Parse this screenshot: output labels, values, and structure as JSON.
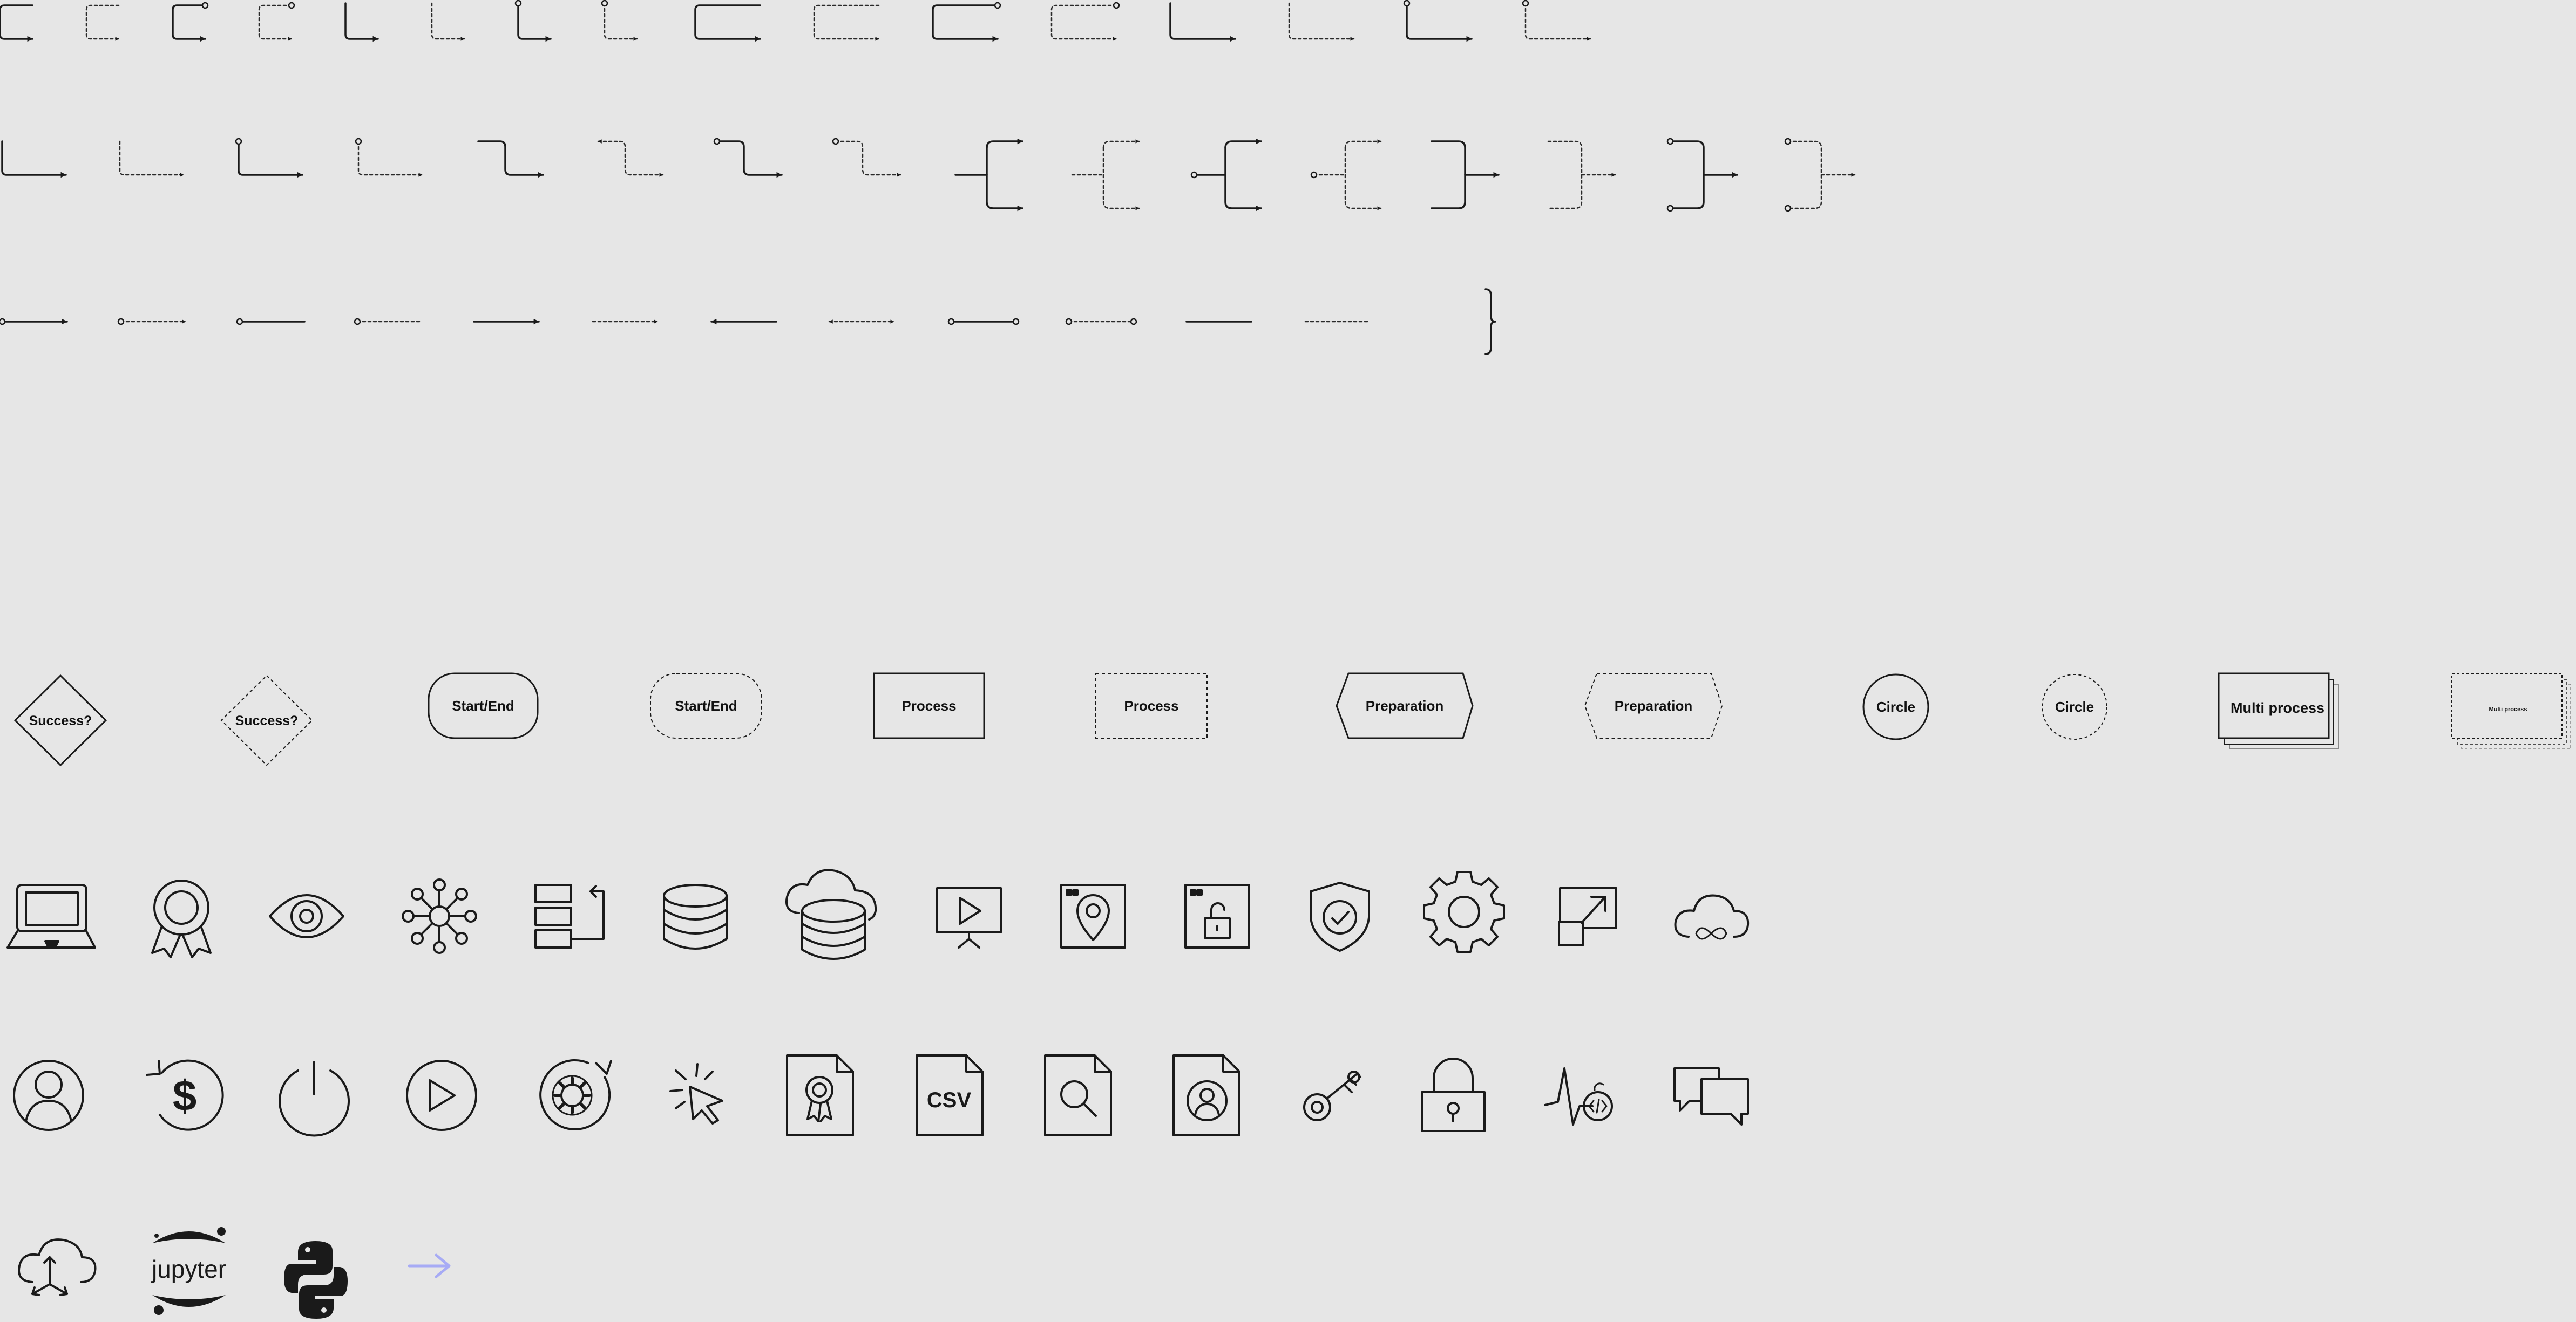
{
  "palette": {
    "background": "#e6e6e6",
    "stroke": "#1a1a1a",
    "dashed_stroke": "#2a2a2a",
    "arrow_accent": "#a7abf5"
  },
  "connectors": {
    "row1": [
      "elbow-bracket-arrow",
      "elbow-bracket-arrow-dashed",
      "elbow-bracket-dot-arrow",
      "elbow-bracket-dot-arrow-dashed",
      "elbow-down-right-arrow",
      "elbow-down-right-arrow-dashed",
      "elbow-down-right-dot-arrow",
      "elbow-down-right-dot-arrow-dashed",
      "wide-bracket-arrow",
      "wide-bracket-arrow-dashed",
      "wide-bracket-dot-arrow",
      "wide-bracket-dot-arrow-dashed",
      "wide-down-right-arrow",
      "wide-down-right-arrow-dashed",
      "wide-down-right-dot-arrow",
      "wide-down-right-dot-arrow-dashed"
    ],
    "row2": [
      "elbow-long-arrow",
      "elbow-long-arrow-dashed",
      "elbow-long-dot-arrow",
      "elbow-long-dot-arrow-dashed",
      "step-right-arrow",
      "step-right-back-arrow",
      "step-right-dot-arrow",
      "step-right-dot-arrow-dashed",
      "fork-left-arrow",
      "fork-left-arrow-dashed",
      "fork-left-dot-arrow",
      "fork-left-dot-arrow-dashed",
      "fork-right-arrow",
      "fork-right-arrow-dashed",
      "fork-right-dot-arrow",
      "fork-right-dot-arrow-dashed"
    ],
    "row3": [
      "straight-dot-arrow",
      "straight-dot-arrow-dashed",
      "straight-dot-line",
      "straight-dot-line-dashed",
      "straight-arrow",
      "straight-arrow-dashed",
      "straight-back-arrow",
      "straight-double-arrow-dashed",
      "straight-dot-dot-line",
      "straight-dot-dot-line-dashed",
      "straight-line",
      "straight-line-dashed",
      "curly-brace"
    ]
  },
  "flowchart_shapes": {
    "decision_label": "Success?",
    "decision_dashed_label": "Success?",
    "terminal_label": "Start/End",
    "terminal_dashed_label": "Start/End",
    "process_label": "Process",
    "process_dashed_label": "Process",
    "preparation_label": "Preparation",
    "preparation_dashed_label": "Preparation",
    "circle_label": "Circle",
    "circle_dashed_label": "Circle",
    "multi_process_label": "Multi process",
    "multi_process_dashed_label": "Multi process"
  },
  "icons": {
    "row1": [
      "laptop-icon",
      "award-ribbon-icon",
      "eye-icon",
      "network-hub-icon",
      "list-flow-icon",
      "database-icon",
      "cloud-database-icon",
      "presentation-play-icon",
      "window-location-icon",
      "window-unlock-icon",
      "shield-check-icon",
      "gear-icon",
      "resize-expand-icon",
      "cloud-infinity-icon"
    ],
    "row2": [
      "user-circle-icon",
      "dollar-refresh-icon",
      "power-icon",
      "play-circle-icon",
      "gear-refresh-icon",
      "cursor-click-icon",
      "document-award-icon",
      "document-csv-icon",
      "document-search-icon",
      "document-user-icon",
      "key-icon",
      "padlock-icon",
      "activity-code-icon",
      "chat-bubbles-icon"
    ],
    "csv_label": "CSV",
    "row3": [
      "cloud-share-icon",
      "jupyter-logo",
      "python-logo",
      "arrow-right-icon"
    ],
    "jupyter_label": "jupyter"
  }
}
